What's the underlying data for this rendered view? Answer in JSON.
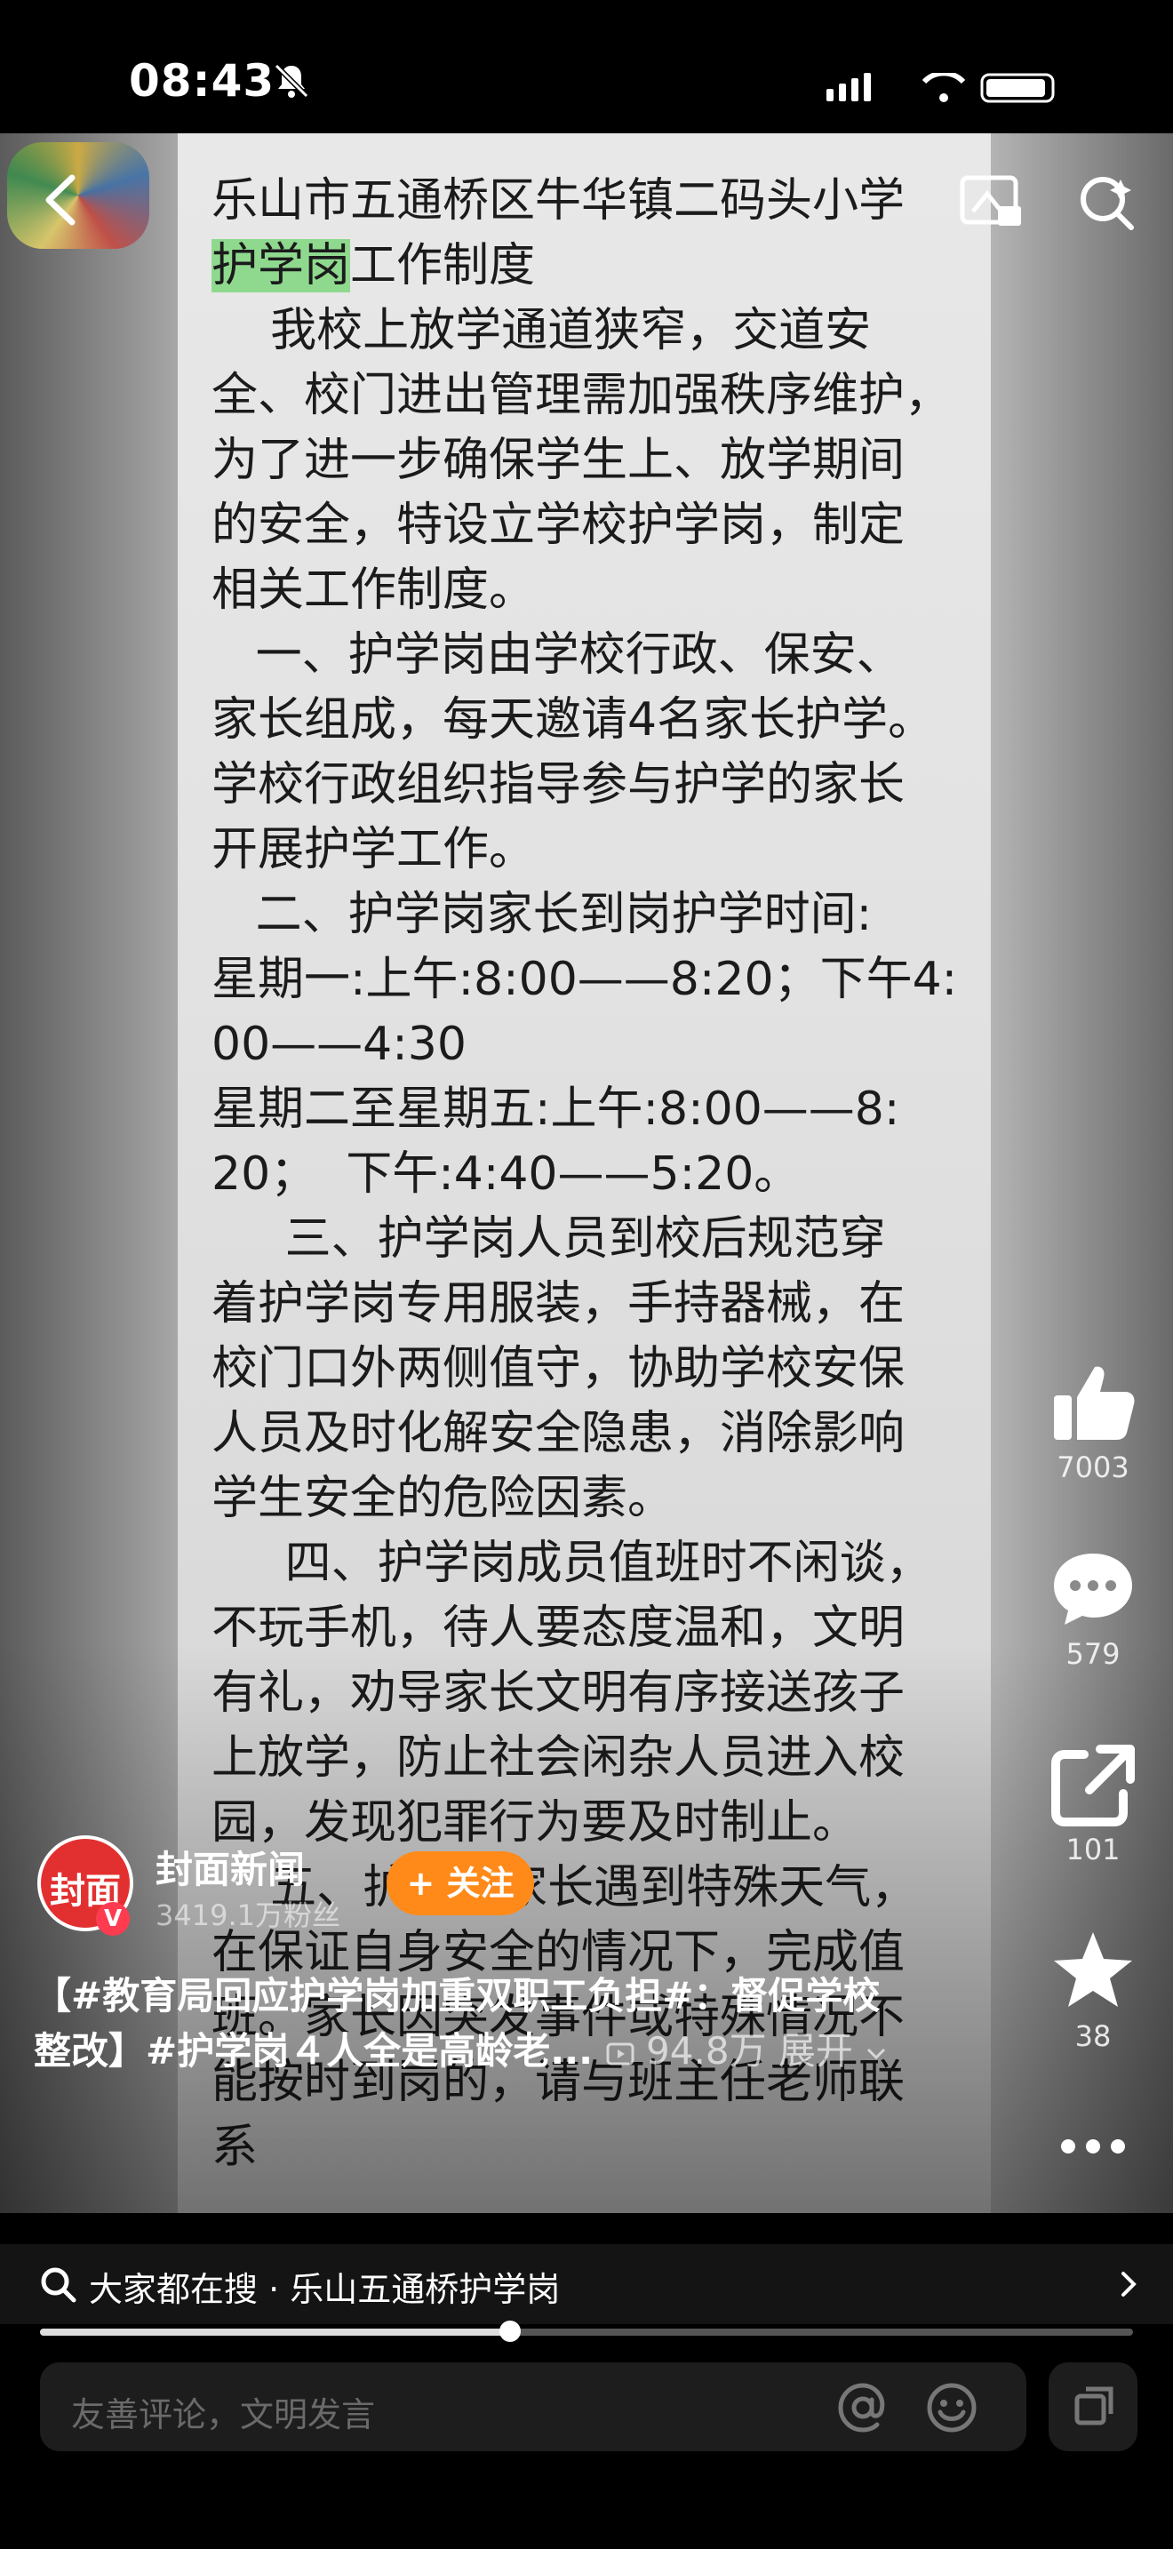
{
  "status": {
    "time": "08:43"
  },
  "document": {
    "lines": [
      "乐山市五通桥区牛华镇二码头小学",
      "",
      "    我校上放学通道狭窄，交道安",
      "全、校门进出管理需加强秩序维护，",
      "为了进一步确保学生上、放学期间",
      "的安全，特设立学校护学岗，制定",
      "相关工作制度。",
      "   一、护学岗由学校行政、保安、",
      "家长组成，每天邀请4名家长护学。",
      "学校行政组织指导参与护学的家长",
      "开展护学工作。",
      "   二、护学岗家长到岗护学时间:",
      "星期一:上午:8:00——8:20；下午4:",
      "00——4:30",
      "星期二至星期五:上午:8:00——8:",
      "20；  下午:4:40——5:20。",
      "     三、护学岗人员到校后规范穿",
      "着护学岗专用服装，手持器械，在",
      "校门口外两侧值守，协助学校安保",
      "人员及时化解安全隐患，消除影响",
      "学生安全的危险因素。",
      "     四、护学岗成员值班时不闲谈，",
      "不玩手机，待人要态度温和，文明",
      "有礼，劝导家长文明有序接送孩子",
      "上放学，防止社会闲杂人员进入校",
      "园，发现犯罪行为要及时制止。",
      "    五、护学岗家长遇到特殊天气，",
      "在保证自身安全的情况下，完成值",
      "班。家长因突发事件或特殊情况不",
      "能按时到岗的，请与班主任老师联",
      "系"
    ],
    "title_highlight": "护学岗",
    "title_rest": "工作制度"
  },
  "actions": {
    "like_count": "7003",
    "comment_count": "579",
    "share_count": "101",
    "favorite_count": "38"
  },
  "author": {
    "avatar_text": "封面",
    "verified_mark": "V",
    "name": "封面新闻",
    "fans": "3419.1万粉丝",
    "follow_label": "+ 关注"
  },
  "caption": {
    "line1": "【#教育局回应护学岗加重双职工负担#：督促学校",
    "line2_text": "整改】#护学岗４人全是高龄老...",
    "line2_stats": "94.8万 展开"
  },
  "progress": {
    "fraction": 0.43
  },
  "search_strip": {
    "text": "大家都在搜 · 乐山五通桥护学岗"
  },
  "comment": {
    "placeholder": "友善评论，文明发言"
  },
  "colors": {
    "follow": "#ff8a1a",
    "highlight": "#8fd98f",
    "avatar": "#e23030"
  }
}
